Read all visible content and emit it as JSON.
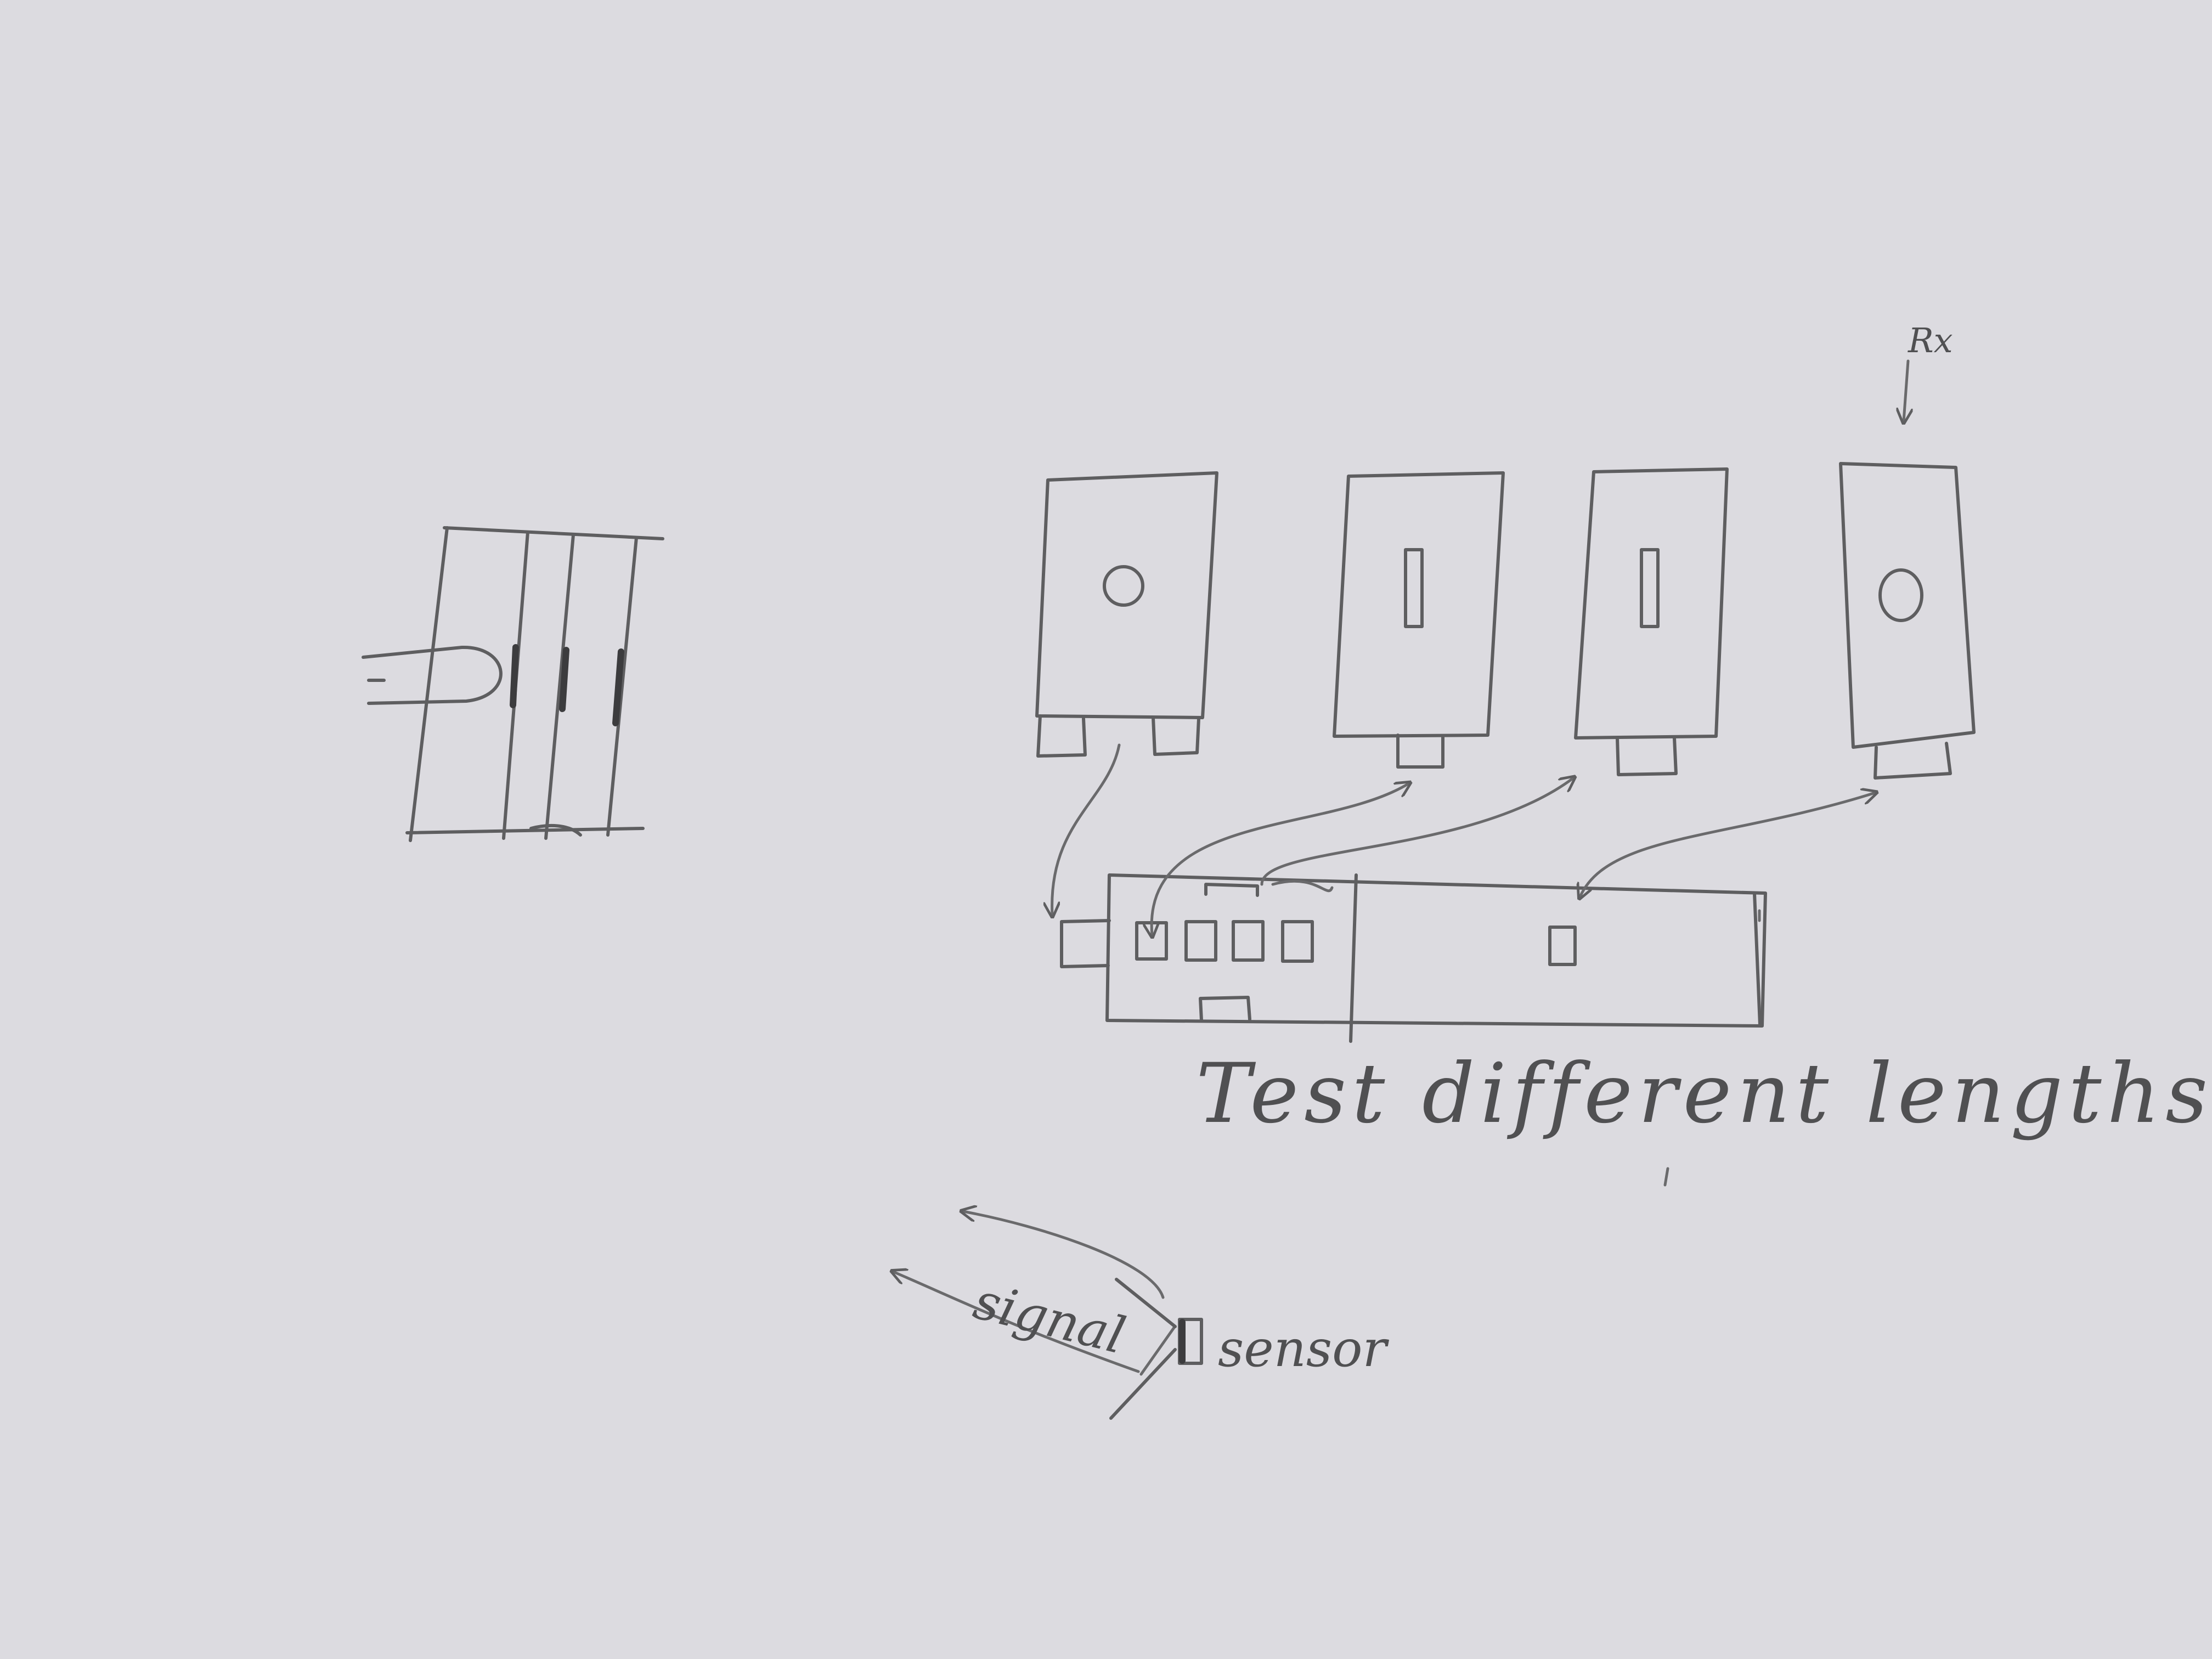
{
  "paper": {
    "background": "#dcdbe0",
    "pencil": "#5e5e60"
  },
  "labels": {
    "receiver_mark": "Rx",
    "caption": "Test different lengths",
    "signal": "signal",
    "sensor": "sensor"
  },
  "modules": [
    {
      "name": "module-1",
      "window": "circle"
    },
    {
      "name": "module-2",
      "window": "slot"
    },
    {
      "name": "module-3",
      "window": "slot"
    },
    {
      "name": "module-4",
      "window": "circle",
      "marked": "Rx"
    }
  ],
  "board": {
    "sockets": 4,
    "receiver_socket": 1
  }
}
